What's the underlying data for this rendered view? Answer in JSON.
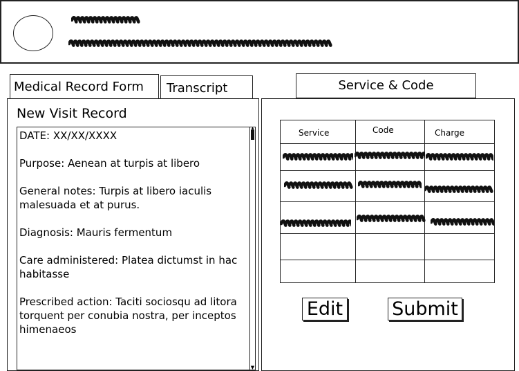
{
  "colors": {
    "stroke": "#222222",
    "background": "#ffffff",
    "scribble": "#111111"
  },
  "header": {
    "avatar_icon": "avatar-circle",
    "name_placeholder": "redacted-scribble",
    "details_placeholder": "redacted-scribble"
  },
  "tabs": {
    "medical_record_form": "Medical Record Form",
    "transcript": "Transcript",
    "service_code": "Service & Code"
  },
  "form": {
    "title": "New Visit Record",
    "entries": [
      "DATE: XX/XX/XXXX",
      "Purpose: Aenean at turpis at libero",
      "General notes: Turpis at libero iaculis malesuada et at purus.",
      "Diagnosis: Mauris fermentum",
      "Care administered: Platea dictumst in hac habitasse",
      "Prescribed action: Taciti sociosqu ad litora torquent per conubia nostra, per inceptos himenaeos"
    ]
  },
  "service_table": {
    "headers": [
      "Service",
      "Code",
      "Charge"
    ],
    "rows_filled": 3,
    "rows_empty": 2,
    "cell_placeholder": "redacted-scribble"
  },
  "buttons": {
    "edit": "Edit",
    "submit": "Submit"
  }
}
